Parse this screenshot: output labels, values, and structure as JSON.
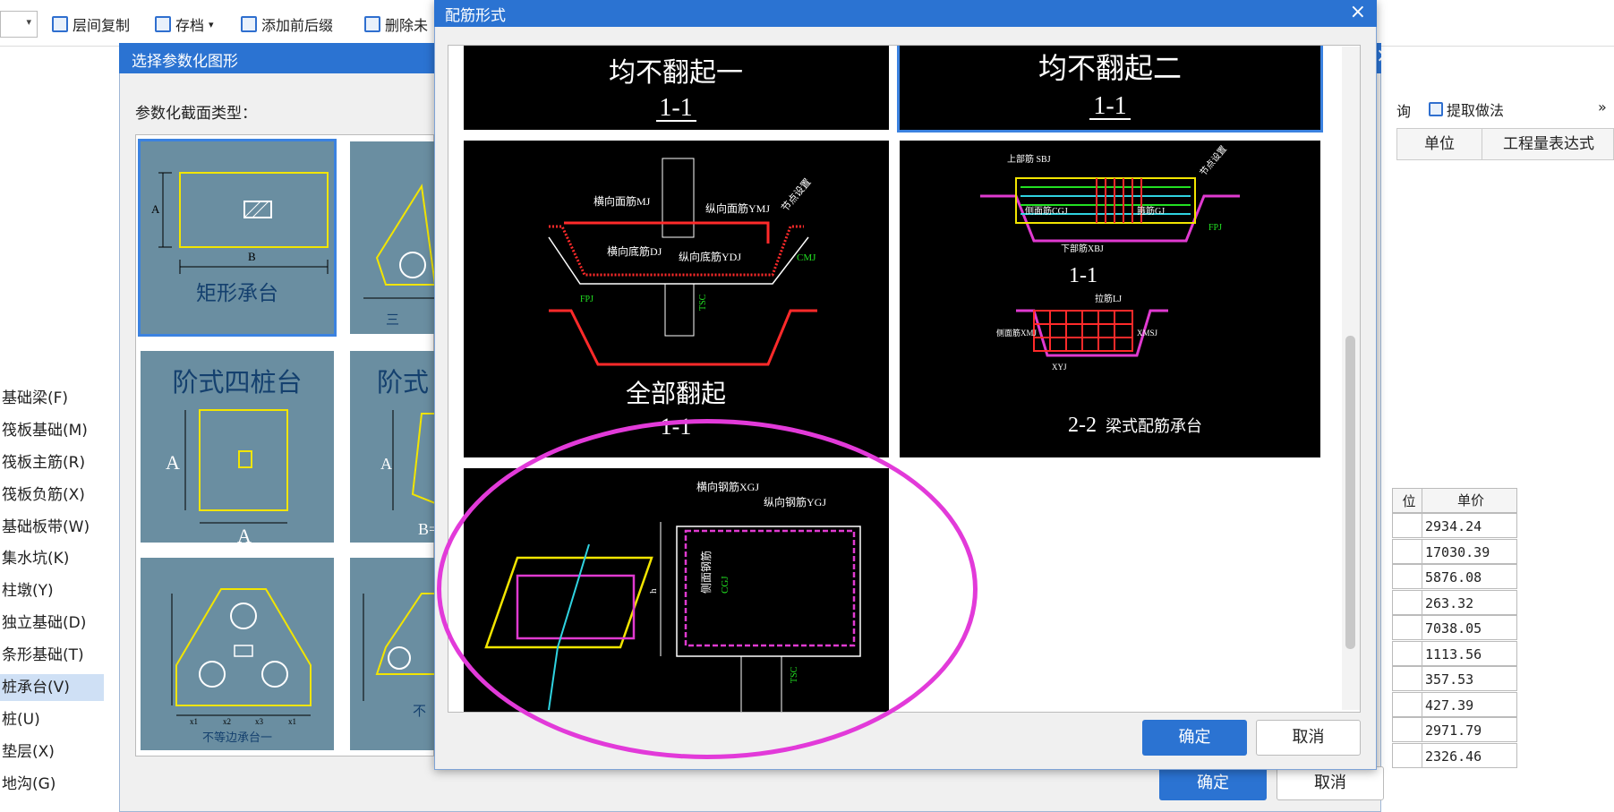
{
  "toolbar": {
    "items": [
      "层间复制",
      "存档",
      "添加前后缀",
      "删除未"
    ],
    "dropdown_arrow": "▾"
  },
  "left_nav": {
    "items": [
      "基础梁(F)",
      "筏板基础(M)",
      "筏板主筋(R)",
      "筏板负筋(X)",
      "基础板带(W)",
      "集水坑(K)",
      "柱墩(Y)",
      "独立基础(D)",
      "条形基础(T)",
      "桩承台(V)",
      "桩(U)",
      "垫层(X)",
      "地沟(G)"
    ],
    "selected_index": 9
  },
  "right_panel": {
    "tab_partial": "询",
    "extract_label": "提取做法",
    "more": "»",
    "columns": [
      "单位",
      "工程量表达式"
    ],
    "price_header_partial": "位",
    "price_header": "单价",
    "prices": [
      "2934.24",
      "17030.39",
      "5876.08",
      "263.32",
      "7038.05",
      "1113.56",
      "357.53",
      "427.39",
      "2971.79",
      "2326.46"
    ]
  },
  "back_dialog": {
    "title": "选择参数化图形",
    "label": "参数化截面类型：",
    "close": "×",
    "ok": "确定",
    "cancel": "取消",
    "shapes": [
      {
        "name": "矩形承台",
        "dims": [
          "A",
          "B"
        ]
      },
      {
        "name": "三",
        "dims": []
      },
      {
        "name": "阶式四桩台",
        "dims": [
          "A",
          "A"
        ]
      },
      {
        "name": "阶式",
        "dims": [
          "A",
          "B="
        ]
      },
      {
        "name": "不等边承台一",
        "dims": [
          "x1",
          "x2",
          "x3",
          "x1"
        ]
      },
      {
        "name": "不",
        "dims": []
      }
    ]
  },
  "front_dialog": {
    "title": "配筋形式",
    "close": "×",
    "ok": "确定",
    "cancel": "取消",
    "panels": [
      {
        "title": "均不翻起一",
        "section": "1-1"
      },
      {
        "title": "均不翻起二",
        "section": "1-1"
      },
      {
        "title": "全部翻起",
        "section": "1-1",
        "labels": [
          "横向面筋MJ",
          "纵向面筋YMJ",
          "横向底筋DJ",
          "纵向底筋YDJ",
          "CMJ",
          "TSC",
          "FPJ",
          "节点设置"
        ]
      },
      {
        "title": "梁式配筋承台",
        "section": "1-1",
        "section2": "2-2",
        "labels": [
          "上部筋 SBJ",
          "侧面筋CGJ",
          "箍筋GJ",
          "下部筋XBJ",
          "FPJ",
          "拉筋LJ",
          "侧面筋XMJ",
          "XMSJ",
          "XYJ",
          "节点设置"
        ]
      },
      {
        "title": "",
        "section": "",
        "labels": [
          "横向钢筋XGJ",
          "纵向钢筋YGJ",
          "侧面钢筋",
          "CGJ",
          "TSC",
          "h"
        ]
      }
    ]
  },
  "colors": {
    "title_bar": "#2b73d2",
    "highlight": "#e23ad9",
    "cad_bg": "#000000",
    "rebar_red": "#ff2a2a",
    "rebar_green": "#22e022",
    "rebar_yellow": "#f2e500",
    "rebar_magenta": "#e03ad0",
    "rebar_cyan": "#2fd3e0"
  }
}
